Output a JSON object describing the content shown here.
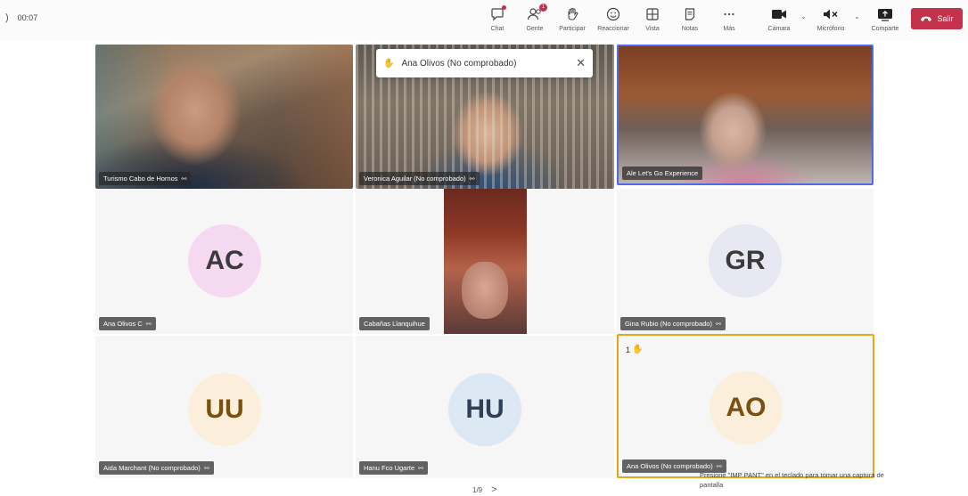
{
  "meeting": {
    "timer": "00:07",
    "shield_glyph": ")"
  },
  "toolbar": {
    "chat": "Chat",
    "people": "Gente",
    "people_badge": "1",
    "participate": "Participar",
    "react": "Reaccionar",
    "view": "Vista",
    "notes": "Notas",
    "more": "Más",
    "camera": "Cámara",
    "mic": "Micrófono",
    "share": "Comparte",
    "leave": "Salir"
  },
  "toast": {
    "name": "Ana Olivos (No comprobado)"
  },
  "participants": [
    {
      "name": "Turismo Cabo de Hornos",
      "type": "video"
    },
    {
      "name": "Veronica Aguilar (No comprobado)",
      "type": "video"
    },
    {
      "name": "Ale Let's Go Experience",
      "type": "video"
    },
    {
      "name": "Ana Olivos C",
      "initials": "AC",
      "type": "avatar"
    },
    {
      "name": "Cabañas Llanquihue",
      "type": "video"
    },
    {
      "name": "Gina Rubio (No comprobado)",
      "initials": "GR",
      "type": "avatar"
    },
    {
      "name": "Aida Marchant (No comprobado)",
      "initials": "UU",
      "type": "avatar"
    },
    {
      "name": "Hanu Fco Ugarte",
      "initials": "HU",
      "type": "avatar"
    },
    {
      "name": "Ana Olivos (No comprobado)",
      "initials": "AO",
      "type": "avatar",
      "hand_count": "1"
    }
  ],
  "hint": "Presione \"IMP PANT\" en el teclado para tomar una captura de pantalla",
  "pager": {
    "label": "1/9",
    "next": ">"
  },
  "colors": {
    "leave": "#c4314b",
    "raised_border": "#e8a514",
    "avatar_ac": "#f5d9f1",
    "avatar_gr": "#e8e8f3",
    "avatar_uu": "#fbefdc",
    "avatar_hu": "#dde8f5",
    "avatar_ao": "#fbefdc"
  }
}
